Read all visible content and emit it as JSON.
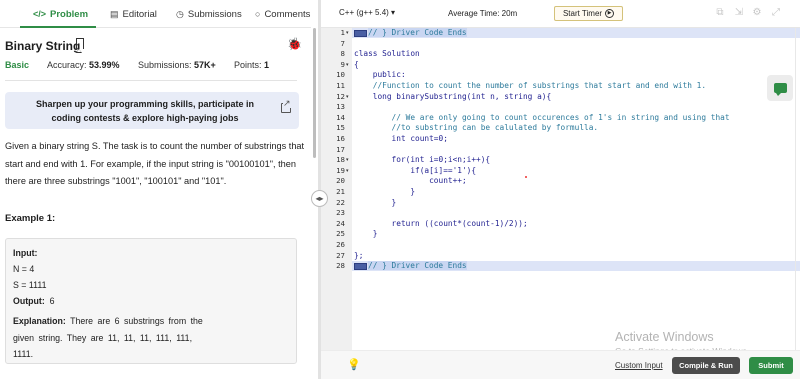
{
  "tabs": {
    "problem": "Problem",
    "editorial": "Editorial",
    "submissions": "Submissions",
    "comments": "Comments",
    "problem_icon": "</>",
    "editorial_icon": "▤",
    "submissions_icon": "◷",
    "comments_icon": "○"
  },
  "problem": {
    "title": "Binary String",
    "difficulty": "Basic",
    "accuracy_label": "Accuracy:",
    "accuracy_value": "53.99%",
    "submissions_label": "Submissions:",
    "submissions_value": "57K+",
    "points_label": "Points:",
    "points_value": "1",
    "description": "Given a binary string S. The task is to count the number of substrings that start and end with 1. For example, if the input string is \"00100101\", then there are three substrings \"1001\", \"100101\" and \"101\"."
  },
  "promo": {
    "text": "Sharpen up your programming skills, participate in coding contests & explore high-paying jobs"
  },
  "example": {
    "title": "Example 1:",
    "input_label": "Input:",
    "n_line": "N = 4",
    "s_line": "S = 1111",
    "output_label": "Output:",
    "output_value": "6",
    "explanation_label": "Explanation:",
    "explanation_text": "There are 6 substrings from the given string. They are 11, 11, 11, 111, 111, 1111."
  },
  "editor_toolbar": {
    "language": "C++ (g++ 5.4) ▾",
    "avg_time": "Average Time: 20m",
    "timer_label": "Start Timer"
  },
  "code": {
    "line_numbers": [
      "1",
      "7",
      "8",
      "9",
      "10",
      "11",
      "12",
      "13",
      "14",
      "15",
      "16",
      "17",
      "18",
      "19",
      "20",
      "21",
      "22",
      "23",
      "24",
      "25",
      "26",
      "27",
      "28"
    ],
    "lines": [
      "// } Driver Code Ends",
      "",
      "class Solution",
      "{",
      "    public:",
      "    //Function to count the number of substrings that start and end with 1.",
      "    long binarySubstring(int n, string a){",
      "",
      "        // We are only going to count occurences of 1's in string and using that",
      "        //to substring can be calulated by formulla.",
      "        int count=0;",
      "",
      "        for(int i=0;i<n;i++){",
      "            if(a[i]=='1'){",
      "                count++;",
      "            }",
      "        }",
      "",
      "        return ((count*(count-1)/2));",
      "    }",
      "",
      "};",
      "// } Driver Code Ends"
    ]
  },
  "watermark": {
    "title": "Activate Windows",
    "subtitle": "Go to Settings to activate Windows."
  },
  "bottom": {
    "custom_input": "Custom Input",
    "compile_run": "Compile & Run",
    "submit": "Submit"
  }
}
